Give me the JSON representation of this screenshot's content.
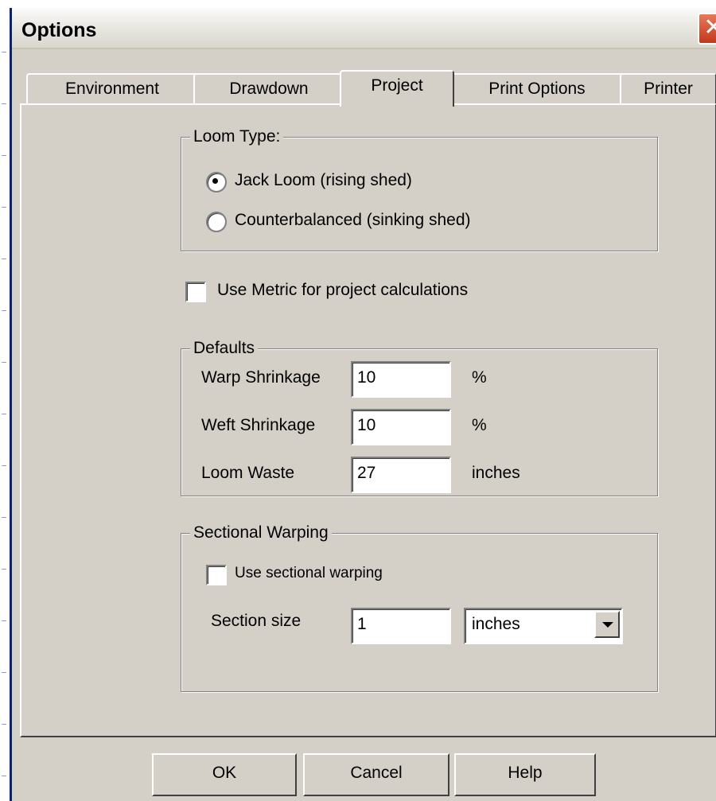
{
  "dialog": {
    "title": "Options",
    "close_glyph": "✕"
  },
  "tabs": [
    {
      "label": "Environment",
      "active": false
    },
    {
      "label": "Drawdown",
      "active": false
    },
    {
      "label": "Project",
      "active": true
    },
    {
      "label": "Print Options",
      "active": false
    },
    {
      "label": "Printer",
      "active": false
    }
  ],
  "loom_type": {
    "legend": "Loom Type:",
    "options": [
      {
        "label": "Jack Loom (rising shed)",
        "selected": true
      },
      {
        "label": "Counterbalanced  (sinking shed)",
        "selected": false
      }
    ]
  },
  "metric": {
    "label": "Use Metric for project calculations",
    "checked": false
  },
  "defaults": {
    "legend": "Defaults",
    "warp_shrinkage": {
      "label": "Warp Shrinkage",
      "value": "10",
      "unit": "%"
    },
    "weft_shrinkage": {
      "label": "Weft Shrinkage",
      "value": "10",
      "unit": "%"
    },
    "loom_waste": {
      "label": "Loom Waste",
      "value": "27",
      "unit": "inches"
    }
  },
  "sectional": {
    "legend": "Sectional Warping",
    "use_label": "Use sectional warping",
    "use_checked": false,
    "size_label": "Section size",
    "size_value": "1",
    "size_unit": "inches"
  },
  "buttons": {
    "ok": "OK",
    "cancel": "Cancel",
    "help": "Help"
  },
  "colors": {
    "face": "#d4d0c8",
    "close": "#c2391d"
  }
}
